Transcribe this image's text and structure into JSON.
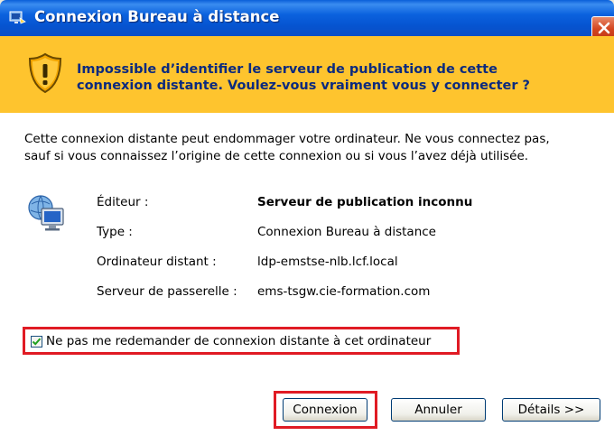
{
  "window": {
    "title": "Connexion Bureau à distance"
  },
  "warning": {
    "line1": "Impossible d’identifier le serveur de publication de cette",
    "line2": "connexion distante. Voulez-vous vraiment vous y connecter ?"
  },
  "description": {
    "line1": "Cette connexion distante peut endommager votre ordinateur. Ne vous connectez pas,",
    "line2": "sauf si vous connaissez l’origine de cette connexion ou si vous l’avez déjà utilisée."
  },
  "details": [
    {
      "label": "Éditeur :",
      "value": "Serveur de publication inconnu"
    },
    {
      "label": "Type :",
      "value": "Connexion Bureau à distance"
    },
    {
      "label": "Ordinateur distant :",
      "value": "ldp-emstse-nlb.lcf.local"
    },
    {
      "label": "Serveur de passerelle :",
      "value": "ems-tsgw.cie-formation.com"
    }
  ],
  "checkbox": {
    "label": "Ne pas me redemander de connexion distante à cet ordinateur",
    "checked": true
  },
  "buttons": {
    "connect": "Connexion",
    "cancel": "Annuler",
    "details": "Détails >>"
  },
  "icons": {
    "app": "rdp-app-icon",
    "close": "close-icon",
    "warning": "warning-shield-icon",
    "computer": "remote-computer-icon",
    "check": "checkmark-icon"
  },
  "colors": {
    "titlebar": "#0a5fd8",
    "warning_banner": "#fec42e",
    "warning_text": "#0b2a7e",
    "highlight": "#e01b24"
  }
}
